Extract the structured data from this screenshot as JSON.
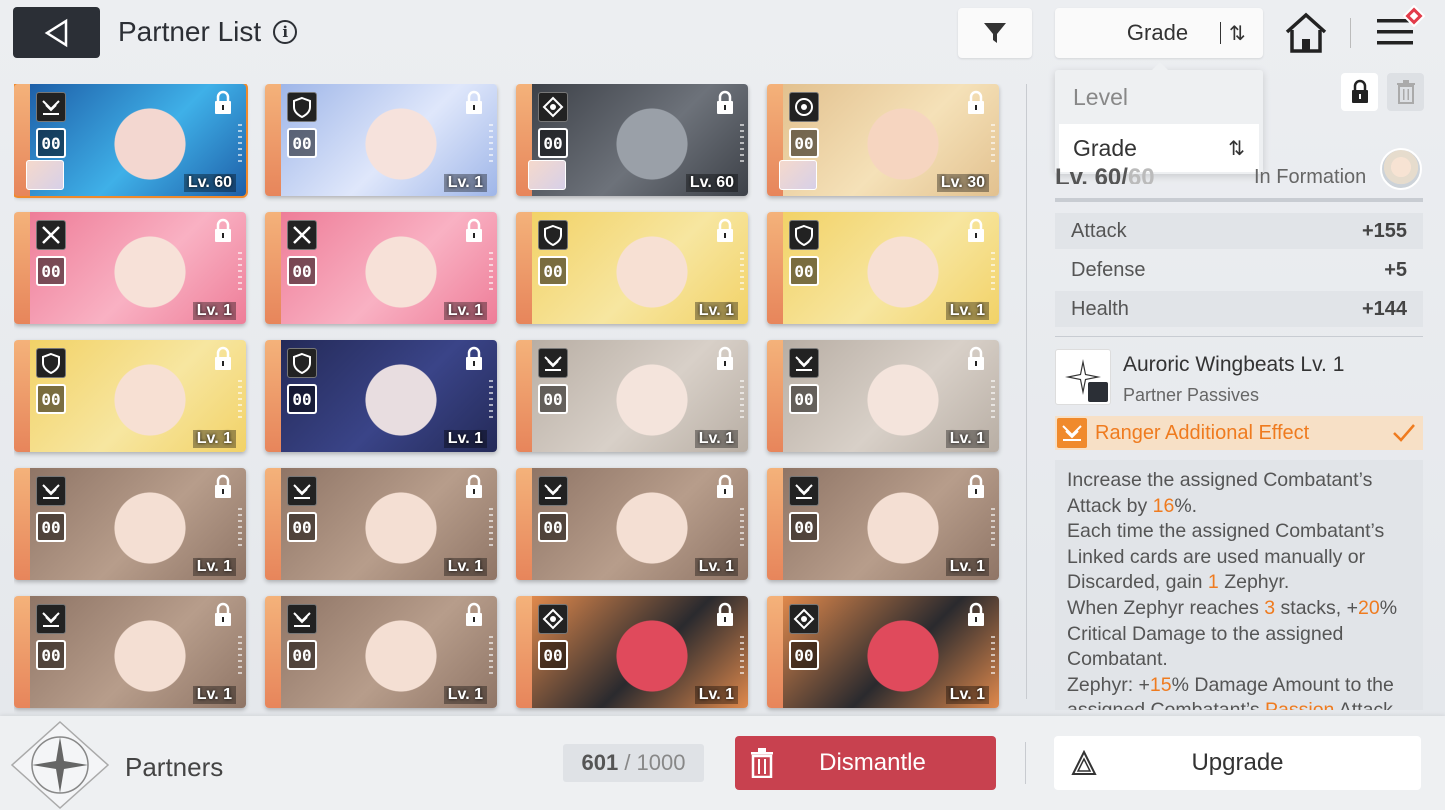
{
  "header": {
    "title": "Partner List",
    "info": "i",
    "sort_label": "Grade",
    "sort_arrows": "⇅"
  },
  "dropdown": {
    "options": [
      {
        "label": "Level"
      },
      {
        "label": "Grade"
      }
    ]
  },
  "cards": [
    {
      "level": "Lv. 60",
      "tag": "00",
      "role": "ranger",
      "selected": true,
      "mini": true
    },
    {
      "level": "Lv. 1",
      "tag": "00",
      "role": "guard"
    },
    {
      "level": "Lv. 60",
      "tag": "00",
      "role": "support",
      "mini": true
    },
    {
      "level": "Lv. 30",
      "tag": "00",
      "role": "target",
      "mini": true
    },
    {
      "level": "Lv. 1",
      "tag": "00",
      "role": "striker"
    },
    {
      "level": "Lv. 1",
      "tag": "00",
      "role": "striker"
    },
    {
      "level": "Lv. 1",
      "tag": "00",
      "role": "guard"
    },
    {
      "level": "Lv. 1",
      "tag": "00",
      "role": "guard"
    },
    {
      "level": "Lv. 1",
      "tag": "00",
      "role": "guard"
    },
    {
      "level": "Lv. 1",
      "tag": "00",
      "role": "guard"
    },
    {
      "level": "Lv. 1",
      "tag": "00",
      "role": "ranger"
    },
    {
      "level": "Lv. 1",
      "tag": "00",
      "role": "ranger"
    },
    {
      "level": "Lv. 1",
      "tag": "00",
      "role": "ranger"
    },
    {
      "level": "Lv. 1",
      "tag": "00",
      "role": "ranger"
    },
    {
      "level": "Lv. 1",
      "tag": "00",
      "role": "ranger"
    },
    {
      "level": "Lv. 1",
      "tag": "00",
      "role": "ranger"
    },
    {
      "level": "Lv. 1",
      "tag": "00",
      "role": "ranger"
    },
    {
      "level": "Lv. 1",
      "tag": "00",
      "role": "ranger"
    },
    {
      "level": "Lv. 1",
      "tag": "00",
      "role": "support"
    },
    {
      "level": "Lv. 1",
      "tag": "00",
      "role": "support"
    }
  ],
  "detail": {
    "level_partial": "Lv. 60/",
    "level_max": "60",
    "formation": "In Formation",
    "stats": [
      {
        "label": "Attack",
        "value": "+155"
      },
      {
        "label": "Defense",
        "value": "+5"
      },
      {
        "label": "Health",
        "value": "+144"
      }
    ],
    "skill_name": "Auroric Wingbeats Lv. 1",
    "skill_type": "Partner Passives",
    "effect_label": "Ranger Additional Effect",
    "desc": {
      "a1": "Increase the assigned Combatant’s Attack by ",
      "a2": "16",
      "a3": "%.",
      "b1": "Each time the assigned Combatant’s Linked cards are used manually or Discarded, gain ",
      "b2": "1",
      "b3": " Zephyr.",
      "c1": "When Zephyr reaches ",
      "c2": "3",
      "c3": " stacks, +",
      "c4": "20",
      "c5": "% Critical Damage to the assigned Combatant.",
      "d1": "Zephyr: +",
      "d2": "15",
      "d3": "% Damage Amount to the assigned Combatant’s ",
      "d4": "Passion",
      "d5": " Attack"
    }
  },
  "footer": {
    "title": "Partners",
    "count_current": "601",
    "count_sep": " / ",
    "count_max": "1000",
    "dismantle_label": "Dismantle",
    "upgrade_label": "Upgrade"
  },
  "colors": {
    "accent_orange": "#ef7b1f",
    "dismantle_red": "#c8414f",
    "dark": "#2b2f36"
  },
  "icons": [
    "back-arrow-icon",
    "info-icon",
    "filter-icon",
    "sort-icon",
    "home-icon",
    "menu-icon",
    "lock-icon",
    "trash-icon",
    "ranger-icon",
    "guard-icon",
    "striker-icon",
    "support-icon",
    "target-icon",
    "sparkle-star-icon",
    "zoom-icon",
    "check-icon",
    "upgrade-arrow-icon",
    "compass-star-icon"
  ]
}
